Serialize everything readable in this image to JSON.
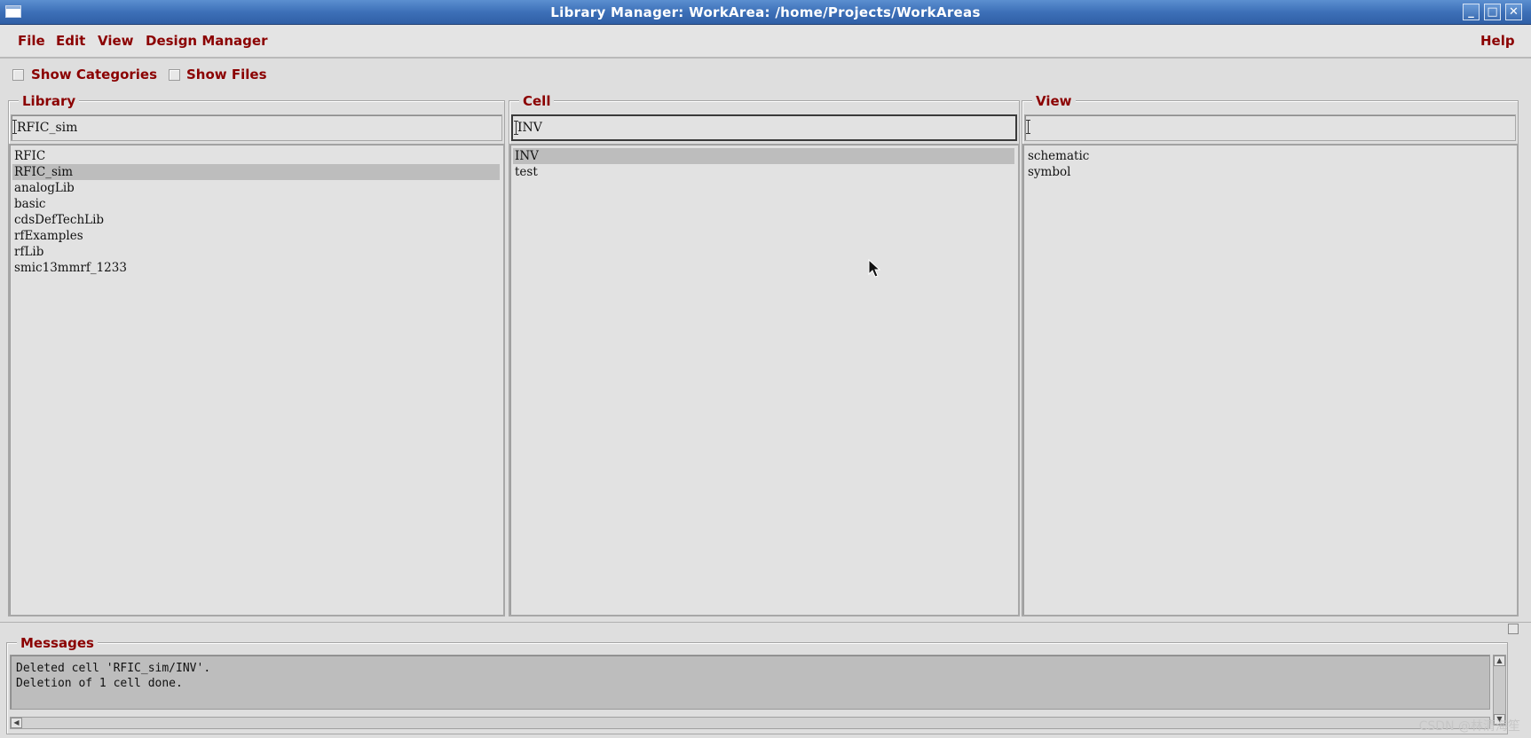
{
  "window": {
    "title": "Library Manager: WorkArea: /home/Projects/WorkAreas",
    "minimize_glyph": "_",
    "maximize_glyph": "□",
    "close_glyph": "✕"
  },
  "menubar": {
    "file": "File",
    "edit": "Edit",
    "view": "View",
    "design_manager": "Design Manager",
    "help": "Help"
  },
  "options": {
    "show_categories": "Show Categories",
    "show_categories_checked": false,
    "show_files": "Show Files",
    "show_files_checked": false
  },
  "library": {
    "label": "Library",
    "filter_value": "RFIC_sim",
    "items": [
      {
        "name": "RFIC",
        "selected": false
      },
      {
        "name": "RFIC_sim",
        "selected": true
      },
      {
        "name": "analogLib",
        "selected": false
      },
      {
        "name": "basic",
        "selected": false
      },
      {
        "name": "cdsDefTechLib",
        "selected": false
      },
      {
        "name": "rfExamples",
        "selected": false
      },
      {
        "name": "rfLib",
        "selected": false
      },
      {
        "name": "smic13mmrf_1233",
        "selected": false
      }
    ]
  },
  "cell": {
    "label": "Cell",
    "filter_value": "INV",
    "items": [
      {
        "name": "INV",
        "selected": true
      },
      {
        "name": "test",
        "selected": false
      }
    ]
  },
  "view": {
    "label": "View",
    "filter_value": "",
    "items": [
      {
        "name": "schematic",
        "selected": false
      },
      {
        "name": "symbol",
        "selected": false
      }
    ]
  },
  "messages": {
    "label": "Messages",
    "lines": [
      "Deleted cell 'RFIC_sim/INV'.",
      "Deletion of 1 cell done."
    ]
  },
  "watermark": "CSDN @林清海笙",
  "colors": {
    "titlebar": "#3d70b8",
    "label_red": "#8b0000",
    "selection": "#bdbdbd",
    "background": "#dedede"
  }
}
